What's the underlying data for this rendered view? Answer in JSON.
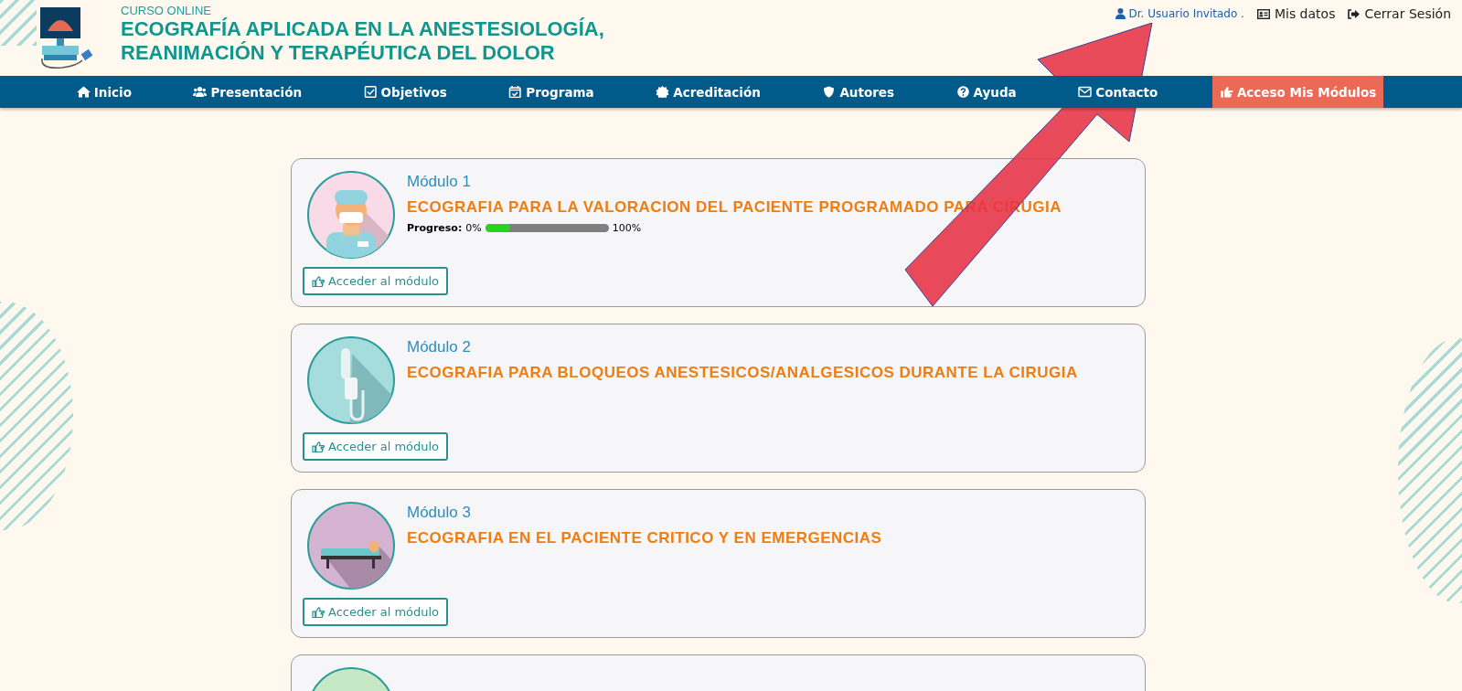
{
  "header": {
    "kicker": "CURSO  ONLINE",
    "title_line_1": "ECOGRAFÍA APLICADA EN LA ANESTESIOLOGÍA,",
    "title_line_2": "REANIMACIÓN Y TERAPÉUTICA DEL DOLOR"
  },
  "user_menu": {
    "user": "Dr. Usuario Invitado .",
    "links": [
      {
        "label": "Mis datos",
        "kind": "card"
      },
      {
        "label": "Cerrar Sesión",
        "kind": "logout"
      }
    ]
  },
  "nav": [
    {
      "label": "Inicio",
      "kind": "home",
      "selected": false
    },
    {
      "label": "Presentación",
      "kind": "users",
      "selected": false
    },
    {
      "label": "Objetivos",
      "kind": "check",
      "selected": false
    },
    {
      "label": "Programa",
      "kind": "calendar",
      "selected": false
    },
    {
      "label": "Acreditación",
      "kind": "badge",
      "selected": false
    },
    {
      "label": "Autores",
      "kind": "shield",
      "selected": false
    },
    {
      "label": "Ayuda",
      "kind": "help",
      "selected": false
    },
    {
      "label": "Contacto",
      "kind": "mail",
      "selected": false
    },
    {
      "label": "Acceso Mis Módulos",
      "kind": "hand",
      "selected": true
    }
  ],
  "modules": [
    {
      "kind": "surgeon",
      "name": "Módulo 1",
      "title": "ECOGRAFIA PARA LA VALORACION DEL PACIENTE PROGRAMADO PARA CIRUGIA",
      "progress": {
        "label": "Progreso:",
        "start": "0%",
        "level": 0.2,
        "end": "100%"
      },
      "button": "Acceder al módulo"
    },
    {
      "kind": "iv",
      "name": "Módulo 2",
      "title": "ECOGRAFIA PARA BLOQUEOS ANESTESICOS/ANALGESICOS DURANTE LA CIRUGIA",
      "button": "Acceder al módulo"
    },
    {
      "kind": "bed",
      "name": "Módulo 3",
      "title": "ECOGRAFIA EN EL PACIENTE CRITICO Y EN EMERGENCIAS",
      "button": "Acceder al módulo"
    },
    {
      "kind": "partial"
    }
  ],
  "annotation": {
    "kind": "arrow"
  }
}
